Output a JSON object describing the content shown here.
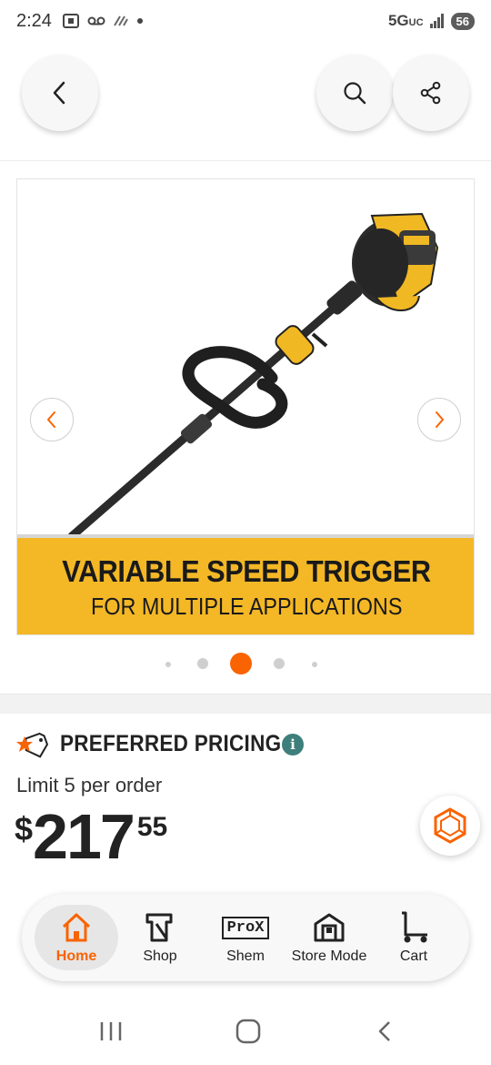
{
  "status_bar": {
    "time": "2:24",
    "network": "5G",
    "network_sub": "UC",
    "battery": "56"
  },
  "header": {
    "back_icon": "chevron-left-icon",
    "search_icon": "search-icon",
    "share_icon": "share-icon"
  },
  "gallery": {
    "banner_line1": "VARIABLE SPEED TRIGGER",
    "banner_line2": "FOR MULTIPLE APPLICATIONS",
    "prev_icon": "chevron-left-icon",
    "next_icon": "chevron-right-icon",
    "active_dot": 3,
    "dot_count": 5,
    "accent_color": "#f96302",
    "banner_color": "#f4b826"
  },
  "pricing": {
    "label": "PREFERRED PRICING",
    "limit": "Limit 5 per order",
    "currency": "$",
    "price_whole": "217",
    "price_cents": "55"
  },
  "bottom_nav": {
    "items": [
      {
        "label": "Home",
        "icon": "home-icon",
        "active": true
      },
      {
        "label": "Shop",
        "icon": "shop-icon",
        "active": false
      },
      {
        "label": "Shem",
        "icon": "prox-icon",
        "icon_text": "ProX",
        "active": false
      },
      {
        "label": "Store Mode",
        "icon": "store-icon",
        "active": false
      },
      {
        "label": "Cart",
        "icon": "cart-icon",
        "active": false
      }
    ]
  }
}
